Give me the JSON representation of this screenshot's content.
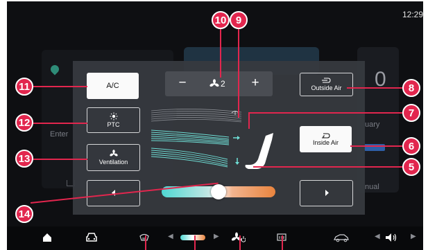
{
  "status_bar": {
    "time": "12:29"
  },
  "background": {
    "enter_label": "Enter",
    "uary_label": "uary",
    "manual_label": "nual",
    "zero_label": "0"
  },
  "climate": {
    "ac_label": "A/C",
    "fan": {
      "minus": "−",
      "plus": "+",
      "level": "2",
      "icon": "fan-icon"
    },
    "outside_air_label": "Outside Air",
    "inside_air_label": "Inside Air",
    "ptc_label": "PTC",
    "ventilation_label": "Ventilation",
    "temperature_level": 0.5,
    "colors": {
      "cool": "#4fd8d3",
      "warm": "#e9843e",
      "airflow": "#6fe0d7",
      "callout": "#e2264e"
    }
  },
  "callouts": [
    "10",
    "9",
    "11",
    "8",
    "12",
    "7",
    "6",
    "13",
    "5",
    "14"
  ],
  "taskbar": {
    "items": [
      "home-icon",
      "car-icon",
      "defrost-front-icon",
      "fan-power-icon",
      "defrost-rear-icon",
      "car-side-icon",
      "volume-icon"
    ]
  }
}
